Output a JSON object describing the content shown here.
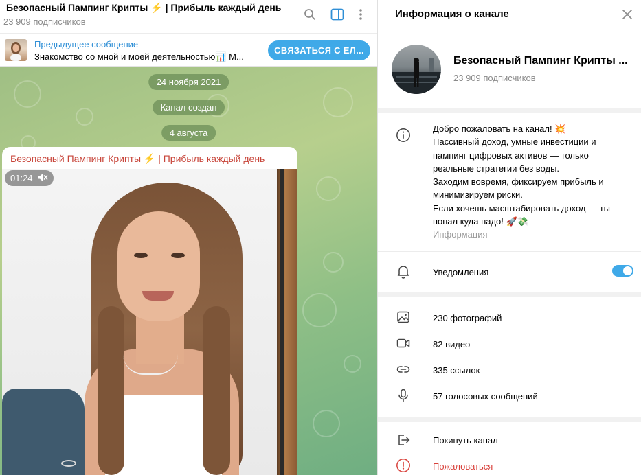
{
  "chat": {
    "title": "Безопасный Пампинг Крипты ⚡️ | Прибыль каждый день",
    "subscribers": "23 909 подписчиков",
    "header_icons": [
      "search-icon",
      "sidebar-toggle-icon",
      "more-vert-icon"
    ]
  },
  "pinned": {
    "title": "Предыдущее сообщение",
    "text": "Знакомство со мной и моей деятельностью📊 М...",
    "button_label": "СВЯЗАТЬСЯ С ЕЛ..."
  },
  "timeline": {
    "date_1": "24 ноября 2021",
    "service_msg": "Канал создан",
    "date_2": "4 августа"
  },
  "message": {
    "author": "Безопасный Пампинг Крипты ⚡️ | Прибыль каждый день",
    "video_duration": "01:24",
    "muted_icon": "mute-icon"
  },
  "panel": {
    "title": "Информация о канале",
    "channel_name": "Безопасный Пампинг Крипты ...",
    "subscribers": "23 909 подписчиков",
    "description_lines": [
      "Добро пожаловать на канал! 💥",
      "Пассивный доход, умные инвестиции и пампинг цифровых активов — только реальные стратегии без воды.",
      "Заходим вовремя, фиксируем прибыль и минимизируем риски.",
      "Если хочешь масштабировать доход — ты попал куда надо! 🚀💸"
    ],
    "description_caption": "Информация",
    "notifications_label": "Уведомления",
    "notifications_on": true,
    "media": {
      "photos": "230 фотографий",
      "videos": "82 видео",
      "links": "335 ссылок",
      "voice": "57 голосовых сообщений"
    },
    "leave_label": "Покинуть канал",
    "report_label": "Пожаловаться",
    "colors": {
      "accent": "#3fa9e8",
      "danger": "#d8403a",
      "author": "#c8453a"
    }
  }
}
